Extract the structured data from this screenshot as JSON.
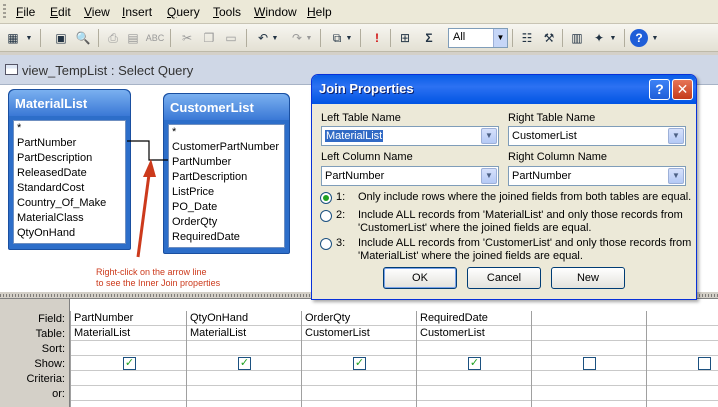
{
  "menubar": {
    "items": [
      {
        "key": "F",
        "rest": "ile"
      },
      {
        "key": "E",
        "rest": "dit"
      },
      {
        "key": "V",
        "rest": "iew"
      },
      {
        "key": "I",
        "rest": "nsert"
      },
      {
        "key": "Q",
        "rest": "uery"
      },
      {
        "key": "T",
        "rest": "ools"
      },
      {
        "key": "W",
        "rest": "indow"
      },
      {
        "key": "H",
        "rest": "elp"
      }
    ]
  },
  "toolbar": {
    "top_values": "All",
    "sigma": "Σ",
    "run": "!",
    "help": "?"
  },
  "query_window": {
    "title": "view_TempList : Select Query"
  },
  "tables": {
    "left": {
      "name": "MaterialList",
      "fields": [
        "*",
        "PartNumber",
        "PartDescription",
        "ReleasedDate",
        "StandardCost",
        "Country_Of_Make",
        "MaterialClass",
        "QtyOnHand"
      ]
    },
    "right": {
      "name": "CustomerList",
      "fields": [
        "*",
        "CustomerPartNumber",
        "PartNumber",
        "PartDescription",
        "ListPrice",
        "PO_Date",
        "OrderQty",
        "RequiredDate"
      ]
    }
  },
  "annotation": {
    "line1": "Right-click on the arrow line",
    "line2": "to see the Inner Join properties"
  },
  "grid": {
    "row_labels": [
      "Field:",
      "Table:",
      "Sort:",
      "Show:",
      "Criteria:",
      "or:"
    ],
    "columns": [
      {
        "field": "PartNumber",
        "table": "MaterialList",
        "show": true
      },
      {
        "field": "QtyOnHand",
        "table": "MaterialList",
        "show": true
      },
      {
        "field": "OrderQty",
        "table": "CustomerList",
        "show": true
      },
      {
        "field": "RequiredDate",
        "table": "CustomerList",
        "show": true
      },
      {
        "field": "",
        "table": "",
        "show": false
      },
      {
        "field": "",
        "table": "",
        "show": false
      }
    ]
  },
  "dialog": {
    "title": "Join Properties",
    "help_button": "?",
    "close_button": "✕",
    "left_table_label": "Left Table Name",
    "right_table_label": "Right Table Name",
    "left_table_value": "MaterialList",
    "right_table_value": "CustomerList",
    "left_column_label": "Left Column Name",
    "right_column_label": "Right Column Name",
    "left_column_value": "PartNumber",
    "right_column_value": "PartNumber",
    "options": [
      {
        "num": "1:",
        "line1": "Only include rows where the joined fields from both tables are equal.",
        "line2": "",
        "selected": true
      },
      {
        "num": "2:",
        "line1": "Include ALL records from 'MaterialList' and only those records from",
        "line2": "'CustomerList' where the joined fields are equal.",
        "selected": false
      },
      {
        "num": "3:",
        "line1": "Include ALL records from 'CustomerList' and only those records from",
        "line2": "'MaterialList' where the joined fields are equal.",
        "selected": false
      }
    ],
    "ok_label": "OK",
    "cancel_label": "Cancel",
    "new_label": "New"
  }
}
